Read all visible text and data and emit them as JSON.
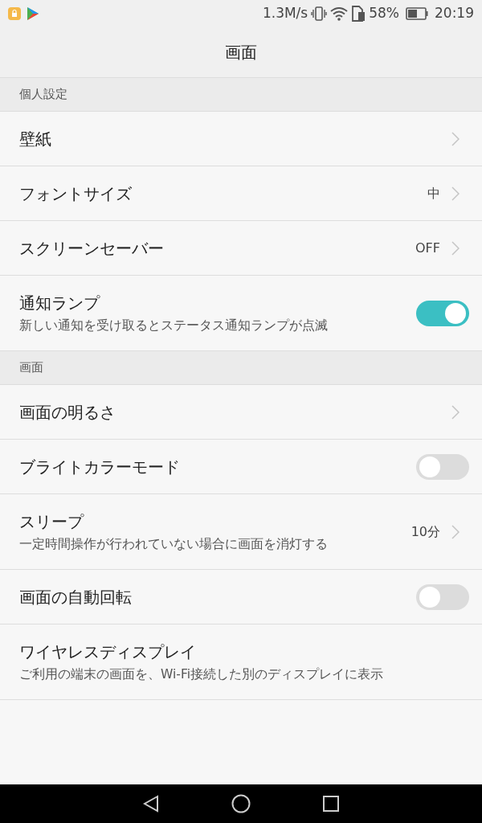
{
  "status_bar": {
    "speed": "1.3M/s",
    "battery_percent": "58%",
    "time": "20:19"
  },
  "title": "画面",
  "sections": [
    {
      "header": "個人設定",
      "items": [
        {
          "kind": "link",
          "title": "壁紙"
        },
        {
          "kind": "link",
          "title": "フォントサイズ",
          "value": "中"
        },
        {
          "kind": "link",
          "title": "スクリーンセーバー",
          "value": "OFF"
        },
        {
          "kind": "toggle",
          "title": "通知ランプ",
          "subtitle": "新しい通知を受け取るとステータス通知ランプが点滅",
          "on": true
        }
      ]
    },
    {
      "header": "画面",
      "items": [
        {
          "kind": "link",
          "title": "画面の明るさ"
        },
        {
          "kind": "toggle",
          "title": "ブライトカラーモード",
          "on": false
        },
        {
          "kind": "link",
          "title": "スリープ",
          "subtitle": "一定時間操作が行われていない場合に画面を消灯する",
          "value": "10分"
        },
        {
          "kind": "toggle",
          "title": "画面の自動回転",
          "on": false
        },
        {
          "kind": "plain",
          "title": "ワイヤレスディスプレイ",
          "subtitle": "ご利用の端末の画面を、Wi-Fi接続した別のディスプレイに表示"
        }
      ]
    }
  ]
}
